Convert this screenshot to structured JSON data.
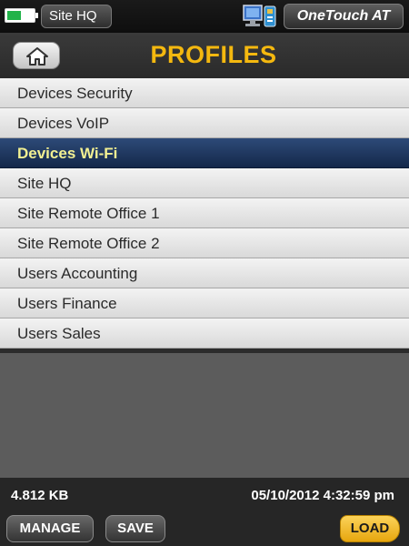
{
  "status_bar": {
    "battery_level": 0.55,
    "battery_color": "#22b34a",
    "profile_name": "Site HQ",
    "network_icon": "network-monitor-icon",
    "brand": "OneTouch AT"
  },
  "header": {
    "home_icon": "home-icon",
    "title": "PROFILES"
  },
  "profiles": [
    {
      "label": "Devices Security",
      "selected": false
    },
    {
      "label": "Devices VoIP",
      "selected": false
    },
    {
      "label": "Devices Wi-Fi",
      "selected": true
    },
    {
      "label": "Site HQ",
      "selected": false
    },
    {
      "label": "Site Remote Office 1",
      "selected": false
    },
    {
      "label": "Site Remote Office 2",
      "selected": false
    },
    {
      "label": "Users Accounting",
      "selected": false
    },
    {
      "label": "Users Finance",
      "selected": false
    },
    {
      "label": "Users Sales",
      "selected": false
    }
  ],
  "footer": {
    "file_size": "4.812 KB",
    "timestamp": "05/10/2012 4:32:59 pm",
    "manage_label": "MANAGE",
    "save_label": "SAVE",
    "load_label": "LOAD"
  },
  "colors": {
    "title": "#f4b80f",
    "selected_bg": "#1f3a66",
    "selected_text": "#f2f092",
    "load_button": "#f5c02e"
  }
}
